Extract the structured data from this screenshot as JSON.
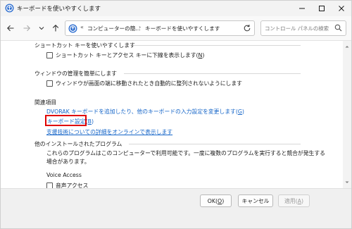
{
  "window": {
    "title": "キーボードを使いやすくします"
  },
  "navbar": {
    "breadcrumb_prefix": "«",
    "breadcrumb_1": "コンピューターの簡...",
    "breadcrumb_sep": "›",
    "breadcrumb_2": "キーボードを使いやすくします",
    "search_placeholder": "コントロール パネルの検索"
  },
  "sections": {
    "shortcut": {
      "title": "ショートカット キーを使いやすくします",
      "checkbox_label": "ショートカット キーとアクセス キーに下線を表示します(",
      "checkbox_key": "N",
      "checkbox_end": ")"
    },
    "window_mgmt": {
      "title": "ウィンドウの管理を簡単にします",
      "checkbox_label": "ウィンドウが画面の端に移動されたとき自動的に整列されないようにします"
    },
    "related": {
      "title": "関連項目",
      "link_dvorak": "DVORAK キーボードを追加したり、他のキーボードの入力設定を変更します(",
      "link_dvorak_key": "G",
      "link_dvorak_end": ")",
      "link_keyboard": "キーボード設定(",
      "link_keyboard_key": "B",
      "link_keyboard_end": ")",
      "link_assist": "支援技術についての詳細をオンラインで表示します"
    },
    "other": {
      "title": "他のインストールされたプログラム",
      "description": "これらのプログラムはこのコンピューターで利用可能です。一度に複数のプログラムを実行すると競合が発生する場合があります。",
      "program_name": "Voice Access",
      "checkbox_label": "音声アクセス"
    }
  },
  "footer": {
    "ok_label": "OK(",
    "ok_key": "O",
    "ok_end": ")",
    "cancel_label": "キャンセル",
    "apply_label": "適用(",
    "apply_key": "A",
    "apply_end": ")"
  },
  "colors": {
    "link": "#1565c8",
    "highlight_box": "#e00000"
  }
}
